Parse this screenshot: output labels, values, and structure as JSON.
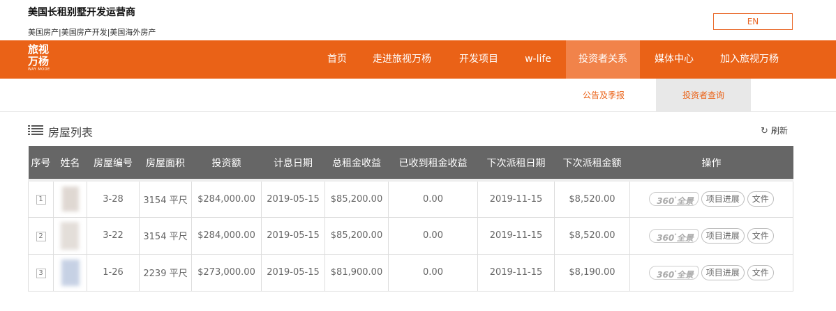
{
  "header": {
    "title": "美国长租别墅开发运营商",
    "subtitle": "美国房产|美国房产开发|美国海外房产",
    "lang_button": "EN"
  },
  "logo": {
    "line1": "旅视",
    "line2": "万杨",
    "small": "WAY MODE"
  },
  "nav": {
    "items": [
      {
        "label": "首页"
      },
      {
        "label": "走进旅视万杨"
      },
      {
        "label": "开发项目"
      },
      {
        "label": "w-life"
      },
      {
        "label": "投资者关系",
        "active": true
      },
      {
        "label": "媒体中心"
      },
      {
        "label": "加入旅视万杨"
      }
    ]
  },
  "subnav": {
    "items": [
      {
        "label": "公告及季报"
      },
      {
        "label": "投资者查询",
        "active": true
      }
    ]
  },
  "list": {
    "title": "房屋列表",
    "refresh_label": "刷新",
    "columns": [
      "序号",
      "姓名",
      "房屋编号",
      "房屋面积",
      "投资额",
      "计息日期",
      "总租金收益",
      "已收到租金收益",
      "下次派租日期",
      "下次派租金额",
      "操作"
    ],
    "rows": [
      {
        "index": "1",
        "house_no": "3-28",
        "area": "3154 平尺",
        "investment": "$284,000.00",
        "start_date": "2019-05-15",
        "total_rent": "$85,200.00",
        "received_rent": "0.00",
        "next_date": "2019-11-15",
        "next_amount": "$8,520.00"
      },
      {
        "index": "2",
        "house_no": "3-22",
        "area": "3154 平尺",
        "investment": "$284,000.00",
        "start_date": "2019-05-15",
        "total_rent": "$85,200.00",
        "received_rent": "0.00",
        "next_date": "2019-11-15",
        "next_amount": "$8,520.00"
      },
      {
        "index": "3",
        "house_no": "1-26",
        "area": "2239 平尺",
        "investment": "$273,000.00",
        "start_date": "2019-05-15",
        "total_rent": "$81,900.00",
        "received_rent": "0.00",
        "next_date": "2019-11-15",
        "next_amount": "$8,190.00"
      }
    ],
    "actions": {
      "pano": "360",
      "pano_sup": "°",
      "pano_text": "全景",
      "progress": "项目进展",
      "files": "文件"
    }
  },
  "colors": {
    "accent": "#ea6217",
    "active_nav": "#f1834a",
    "table_header": "#666666"
  }
}
